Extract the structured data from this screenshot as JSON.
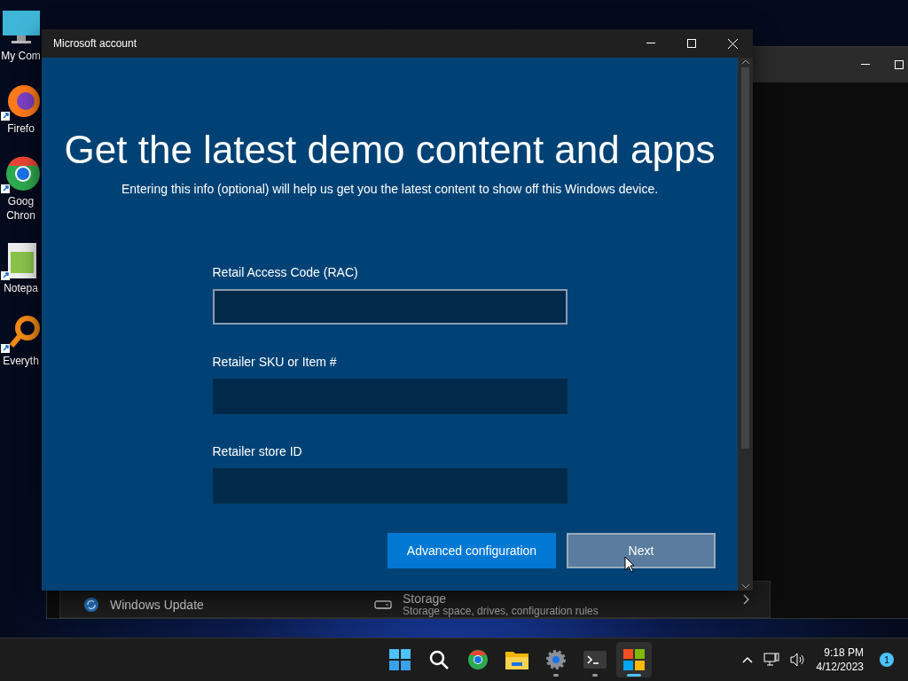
{
  "desktop_icons": [
    {
      "kind": "computer",
      "lines": [
        "My Com"
      ]
    },
    {
      "kind": "firefox",
      "lines": [
        "Firefo"
      ]
    },
    {
      "kind": "chrome",
      "lines": [
        "Goog",
        "Chron"
      ]
    },
    {
      "kind": "notepad",
      "lines": [
        "Notepa"
      ]
    },
    {
      "kind": "everything",
      "lines": [
        "Everyth"
      ]
    }
  ],
  "background_window": {
    "items": [
      {
        "kind": "update",
        "title": "Windows Update"
      },
      {
        "kind": "storage",
        "title": "Storage",
        "subtitle": "Storage space, drives, configuration rules"
      }
    ]
  },
  "dialog": {
    "title": "Microsoft account",
    "heading": "Get the latest demo content and apps",
    "subtitle": "Entering this info (optional) will help us get you the latest content to show off this Windows device.",
    "fields": [
      {
        "label": "Retail Access Code (RAC)",
        "focused": true
      },
      {
        "label": "Retailer SKU or Item #",
        "focused": false
      },
      {
        "label": "Retailer store ID",
        "focused": false
      }
    ],
    "buttons": [
      {
        "label": "Advanced configuration",
        "kind": "accent"
      },
      {
        "label": "Next",
        "kind": "outline"
      }
    ]
  },
  "taskbar": {
    "apps": [
      {
        "kind": "start",
        "running": false,
        "selected": false
      },
      {
        "kind": "search",
        "running": false,
        "selected": false
      },
      {
        "kind": "chrome",
        "running": false,
        "selected": false
      },
      {
        "kind": "folder",
        "running": false,
        "selected": false
      },
      {
        "kind": "settings",
        "running": true,
        "selected": false
      },
      {
        "kind": "terminal",
        "running": true,
        "selected": false
      },
      {
        "kind": "store",
        "running": true,
        "selected": true
      }
    ],
    "time": "9:18 PM",
    "date": "4/12/2023",
    "notifications": "1"
  }
}
